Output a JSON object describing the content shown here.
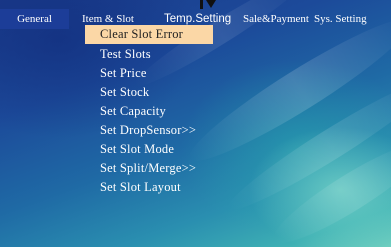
{
  "menubar": {
    "general": "General",
    "item_slot": "Item & Slot",
    "temp_setting": "Temp.Setting",
    "sale_payment": "Sale&Payment",
    "sys_setting": "Sys. Setting"
  },
  "submenu": {
    "items": [
      {
        "label": "Clear Slot Error",
        "selected": true
      },
      {
        "label": "Test Slots"
      },
      {
        "label": "Set Price"
      },
      {
        "label": "Set Stock"
      },
      {
        "label": "Set Capacity"
      },
      {
        "label": "Set DropSensor>>"
      },
      {
        "label": "Set Slot Mode"
      },
      {
        "label": "Set Split/Merge>>"
      },
      {
        "label": "Set Slot Layout"
      }
    ]
  },
  "colors": {
    "active_tab_bg": "#1c3d98",
    "highlight_bg": "#fbd7a6"
  },
  "icons": {
    "marker": "down-arrow-marker-icon"
  }
}
